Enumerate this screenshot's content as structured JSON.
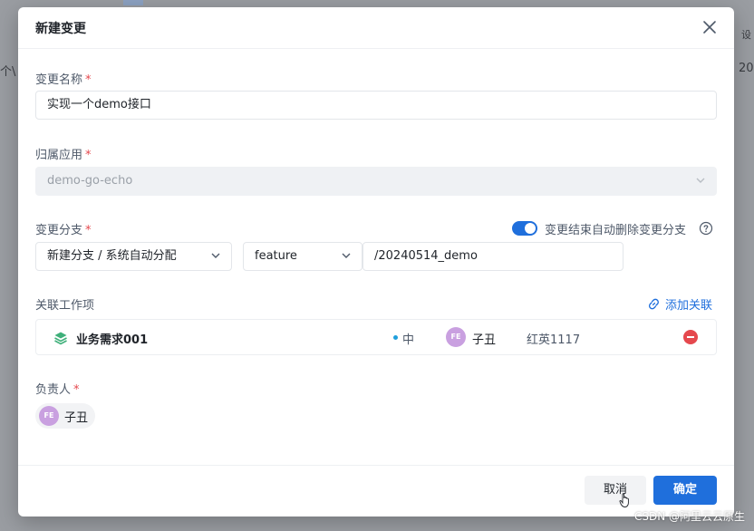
{
  "background": {
    "left_text": "个\\",
    "right_text": "20",
    "right_top_text": "设"
  },
  "modal": {
    "title": "新建变更",
    "close_icon": "close-icon"
  },
  "form": {
    "change_name": {
      "label": "变更名称",
      "required": "*",
      "value": "实现一个demo接口"
    },
    "app": {
      "label": "归属应用",
      "required": "*",
      "value": "demo-go-echo",
      "disabled": true
    },
    "branch": {
      "label": "变更分支",
      "required": "*",
      "mode_value": "新建分支 / 系统自动分配",
      "type_value": "feature",
      "name_value": "/20240514_demo",
      "auto_delete_label": "变更结束自动删除变更分支",
      "auto_delete_on": true
    },
    "work_items": {
      "label": "关联工作项",
      "add_link_label": "添加关联",
      "rows": [
        {
          "title": "业务需求001",
          "priority": "中",
          "avatar": "FE",
          "user": "子丑",
          "iteration": "红英1117"
        }
      ]
    },
    "owner": {
      "label": "负责人",
      "required": "*",
      "avatar": "FE",
      "name": "子丑"
    }
  },
  "footer": {
    "cancel_label": "取消",
    "ok_label": "确定"
  },
  "watermark": "CSDN @阿里云云原生",
  "colors": {
    "primary": "#1f6fdc",
    "danger": "#e5484d",
    "avatar": "#c9a0e0"
  }
}
